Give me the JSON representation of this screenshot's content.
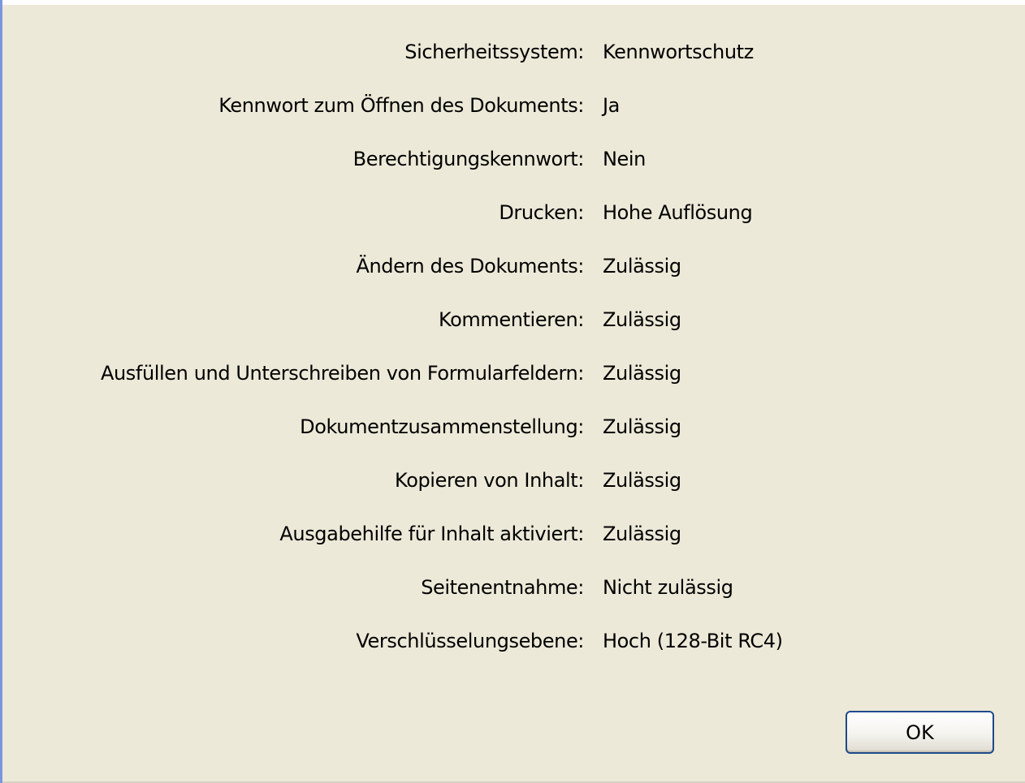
{
  "colors": {
    "dialog_background": "#ece9d8",
    "window_border": "#7a96df",
    "text": "#000000",
    "button_border": "#1f4a8a"
  },
  "security": {
    "rows": [
      {
        "label": "Sicherheitssystem:",
        "value": "Kennwortschutz"
      },
      {
        "label": "Kennwort zum Öffnen des Dokuments:",
        "value": "Ja"
      },
      {
        "label": "Berechtigungskennwort:",
        "value": "Nein"
      },
      {
        "label": "Drucken:",
        "value": "Hohe Auflösung"
      },
      {
        "label": "Ändern des Dokuments:",
        "value": "Zulässig"
      },
      {
        "label": "Kommentieren:",
        "value": "Zulässig"
      },
      {
        "label": "Ausfüllen und Unterschreiben von Formularfeldern:",
        "value": "Zulässig"
      },
      {
        "label": "Dokumentzusammenstellung:",
        "value": "Zulässig"
      },
      {
        "label": "Kopieren von Inhalt:",
        "value": "Zulässig"
      },
      {
        "label": "Ausgabehilfe für Inhalt aktiviert:",
        "value": "Zulässig"
      },
      {
        "label": "Seitenentnahme:",
        "value": "Nicht zulässig"
      },
      {
        "label": "Verschlüsselungsebene:",
        "value": "Hoch (128-Bit RC4)"
      }
    ]
  },
  "buttons": {
    "ok_label": "OK"
  }
}
